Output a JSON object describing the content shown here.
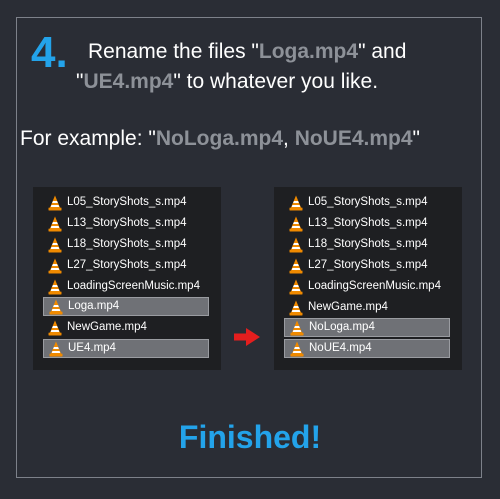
{
  "step": {
    "number": "4."
  },
  "instruction": {
    "line1_prefix": "Rename the files \"",
    "line1_file": "Loga.mp4",
    "line1_suffix": "\" and",
    "line2_prefix": "\"",
    "line2_file": "UE4.mp4",
    "line2_suffix": "\" to whatever you like."
  },
  "example": {
    "prefix": "For example: \"",
    "file1": "NoLoga.mp4",
    "separator": ", ",
    "file2": "NoUE4.mp4",
    "suffix": "\""
  },
  "before_list": {
    "files": [
      {
        "name": "L05_StoryShots_s.mp4",
        "icon": "vlc-icon"
      },
      {
        "name": "L13_StoryShots_s.mp4",
        "icon": "vlc-icon"
      },
      {
        "name": "L18_StoryShots_s.mp4",
        "icon": "vlc-icon"
      },
      {
        "name": "L27_StoryShots_s.mp4",
        "icon": "vlc-icon"
      },
      {
        "name": "LoadingScreenMusic.mp4",
        "icon": "vlc-icon"
      },
      {
        "name": "Loga.mp4",
        "icon": "vlc-icon",
        "selected": true
      },
      {
        "name": "NewGame.mp4",
        "icon": "vlc-icon"
      },
      {
        "name": "UE4.mp4",
        "icon": "vlc-icon",
        "selected": true
      }
    ]
  },
  "after_list": {
    "files": [
      {
        "name": "L05_StoryShots_s.mp4",
        "icon": "vlc-icon"
      },
      {
        "name": "L13_StoryShots_s.mp4",
        "icon": "vlc-icon"
      },
      {
        "name": "L18_StoryShots_s.mp4",
        "icon": "vlc-icon"
      },
      {
        "name": "L27_StoryShots_s.mp4",
        "icon": "vlc-icon"
      },
      {
        "name": "LoadingScreenMusic.mp4",
        "icon": "vlc-icon"
      },
      {
        "name": "NewGame.mp4",
        "icon": "vlc-icon"
      },
      {
        "name": "NoLoga.mp4",
        "icon": "vlc-icon",
        "selected": true
      },
      {
        "name": "NoUE4.mp4",
        "icon": "vlc-icon",
        "selected": true
      }
    ]
  },
  "arrow": {
    "icon": "right-arrow-icon",
    "color": "#e41e1e"
  },
  "footer": {
    "text": "Finished!"
  },
  "colors": {
    "background": "#2a2d35",
    "accent": "#23a3ea",
    "highlight_text": "#8d9198",
    "explorer_bg": "#1e1f22",
    "selection": "#6f7176",
    "vlc_orange": "#f08a00"
  }
}
